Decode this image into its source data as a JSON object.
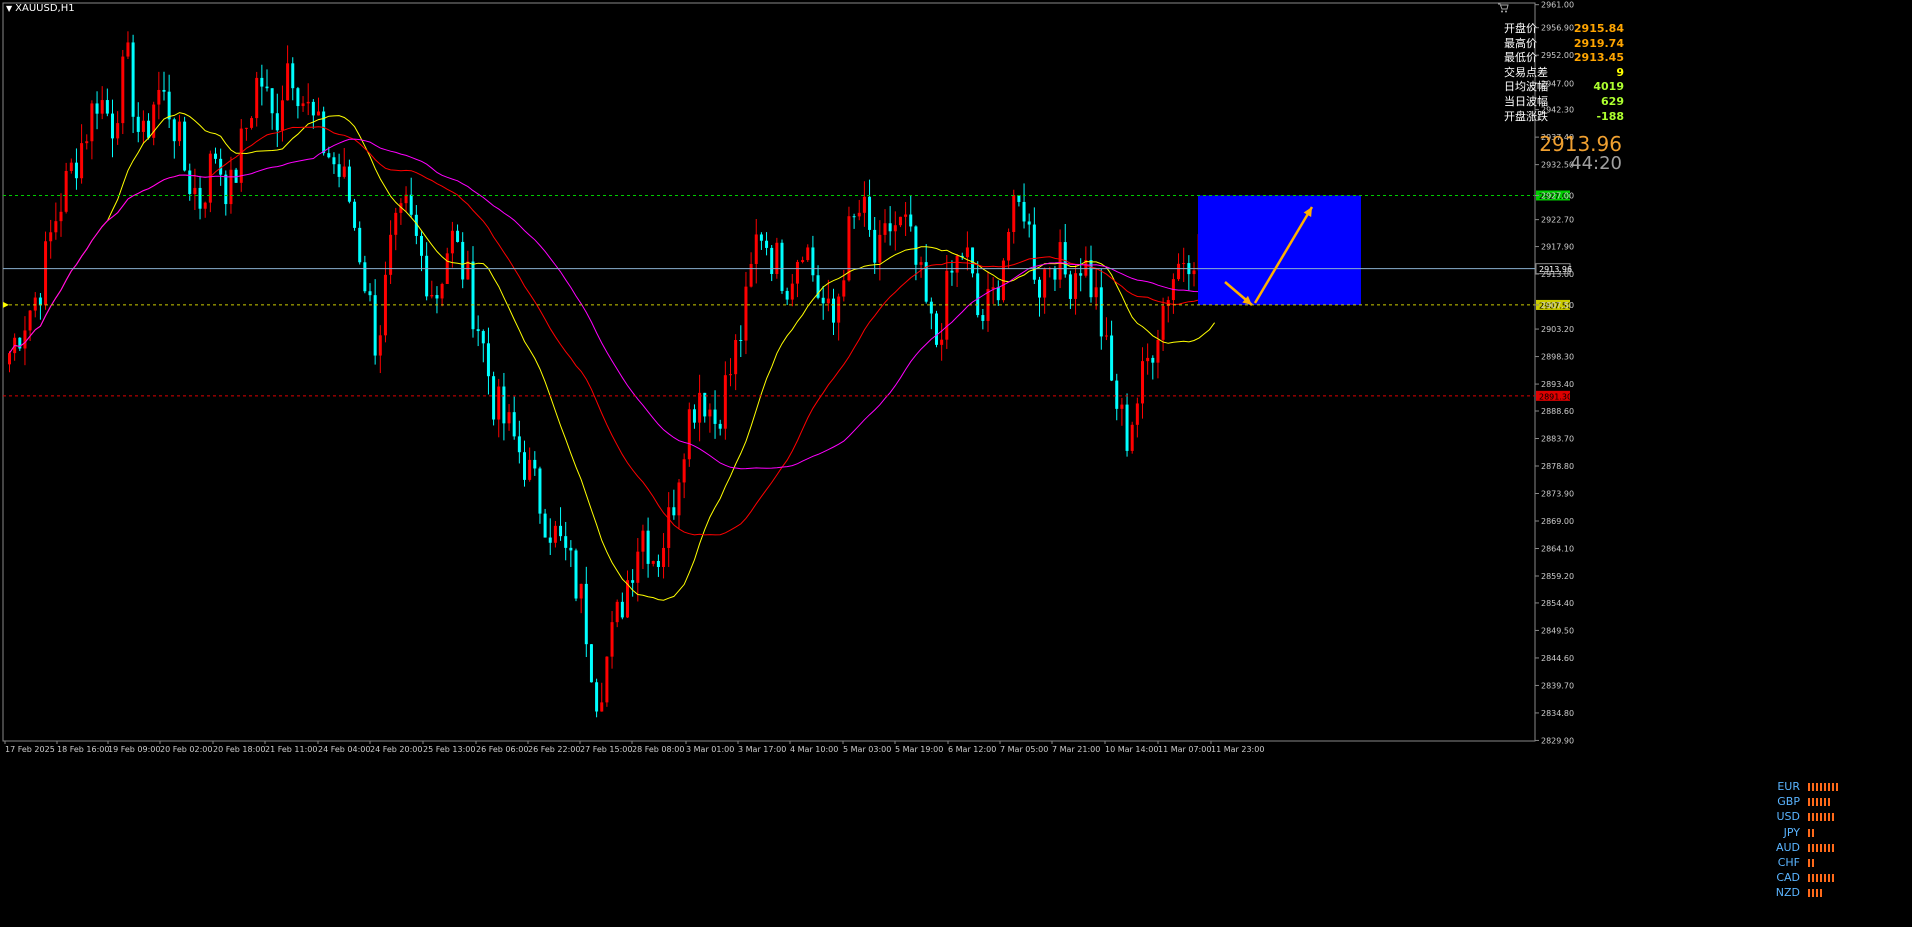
{
  "window": {
    "title": "XAUUSD,H1"
  },
  "info_panel": {
    "rows": [
      {
        "label": "开盘价",
        "value": "2915.84",
        "color": "#ffa500"
      },
      {
        "label": "最高价",
        "value": "2919.74",
        "color": "#ffa500"
      },
      {
        "label": "最低价",
        "value": "2913.45",
        "color": "#ffa500"
      },
      {
        "label": "交易点差",
        "value": "9",
        "color": "#ffff00"
      },
      {
        "label": "日均波幅",
        "value": "4019",
        "color": "#adff2f"
      },
      {
        "label": "当日波幅",
        "value": "629",
        "color": "#adff2f"
      },
      {
        "label": "开盘涨跌",
        "value": "-188",
        "color": "#adff2f"
      }
    ],
    "current_price": "2913.96",
    "countdown": "44:20"
  },
  "currency_strength": [
    {
      "name": "EUR",
      "level": 8
    },
    {
      "name": "GBP",
      "level": 6
    },
    {
      "name": "USD",
      "level": 7
    },
    {
      "name": "JPY",
      "level": 2
    },
    {
      "name": "AUD",
      "level": 7
    },
    {
      "name": "CHF",
      "level": 2
    },
    {
      "name": "CAD",
      "level": 7
    },
    {
      "name": "NZD",
      "level": 4
    }
  ],
  "chart_data": {
    "type": "candlestick",
    "symbol": "XAUUSD",
    "timeframe": "H1",
    "ylim": [
      2829.8,
      2961.3
    ],
    "y_ticks": [
      2961.0,
      2956.9,
      2952.0,
      2947.0,
      2942.3,
      2937.4,
      2932.5,
      2927.0,
      2922.7,
      2917.9,
      2913.0,
      2907.5,
      2903.2,
      2898.3,
      2893.4,
      2888.6,
      2883.7,
      2878.8,
      2873.9,
      2869.0,
      2864.1,
      2859.2,
      2854.4,
      2849.5,
      2844.6,
      2839.7,
      2834.8,
      2829.9
    ],
    "x_labels": [
      "17 Feb 2025",
      "18 Feb 16:00",
      "19 Feb 09:00",
      "20 Feb 02:00",
      "20 Feb 18:00",
      "21 Feb 11:00",
      "24 Feb 04:00",
      "24 Feb 20:00",
      "25 Feb 13:00",
      "26 Feb 06:00",
      "26 Feb 22:00",
      "27 Feb 15:00",
      "28 Feb 08:00",
      "3 Mar 01:00",
      "3 Mar 17:00",
      "4 Mar 10:00",
      "5 Mar 03:00",
      "5 Mar 19:00",
      "6 Mar 12:00",
      "7 Mar 05:00",
      "7 Mar 21:00",
      "10 Mar 14:00",
      "11 Mar 07:00",
      "11 Mar 23:00"
    ],
    "close_path": [
      2899,
      2905,
      2910,
      2922,
      2930,
      2937,
      2945,
      2940,
      2951,
      2935,
      2946,
      2942,
      2931,
      2926,
      2935,
      2927,
      2938,
      2949,
      2939,
      2952,
      2944,
      2938,
      2933,
      2928,
      2915,
      2900,
      2918,
      2924,
      2916,
      2909,
      2920,
      2913,
      2903,
      2890,
      2885,
      2880,
      2873,
      2867,
      2862,
      2854,
      2838,
      2848,
      2858,
      2868,
      2862,
      2870,
      2886,
      2893,
      2887,
      2895,
      2905,
      2922,
      2916,
      2912,
      2920,
      2910,
      2903,
      2919,
      2925,
      2914,
      2922,
      2921,
      2911,
      2900,
      2912,
      2918,
      2904,
      2909,
      2921,
      2926,
      2911,
      2917,
      2912,
      2916,
      2908,
      2893,
      2884,
      2893,
      2903,
      2912,
      2917,
      2918,
      2915
    ],
    "levels": [
      {
        "price": 2927.0,
        "label": "2927.00",
        "color": "#00cc00"
      },
      {
        "price": 2907.5,
        "label": "2907.50",
        "color": "#cccc00"
      },
      {
        "price": 2891.3,
        "label": "2891.30",
        "color": "#dd0000"
      },
      {
        "price": 2913.96,
        "label": "2913.96",
        "color": "#8ab0d0"
      }
    ],
    "ma_fast_color": "#ffff00",
    "ma_mid_color": "#ff0000",
    "ma_slow_color": "#ff00ff",
    "bull_color": "#ff0000",
    "bear_color": "#00ffff",
    "projection_box": {
      "x_start": "11 Mar 23:00",
      "price_top": 2927.0,
      "price_bottom": 2907.5,
      "color": "#0000ff"
    },
    "arrows_color": "#ffb000"
  }
}
